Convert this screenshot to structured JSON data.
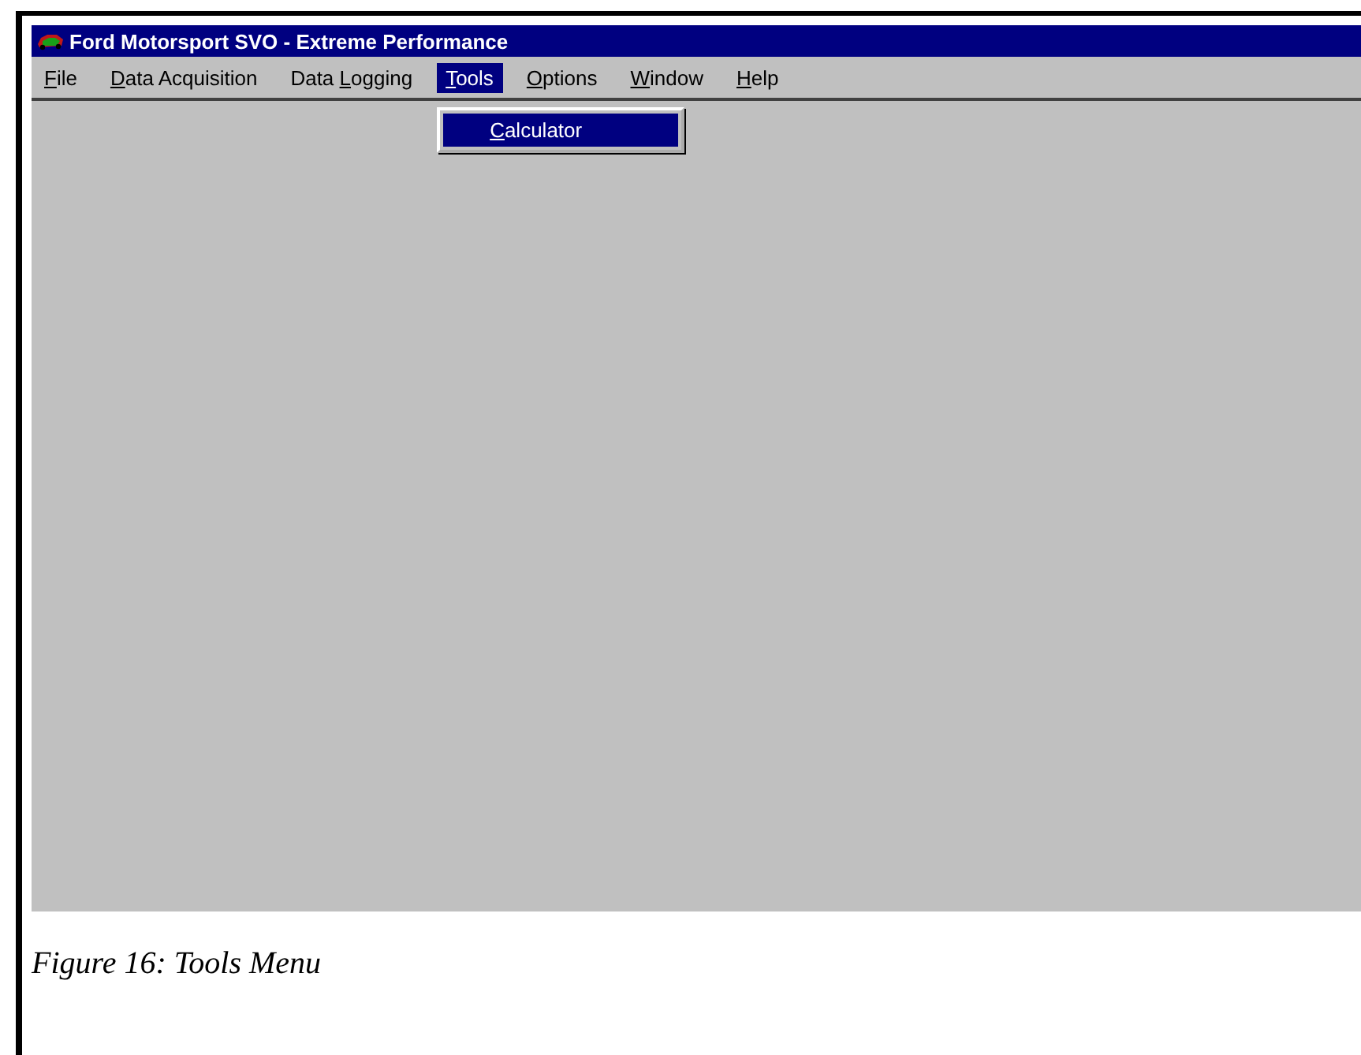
{
  "window": {
    "title": "Ford Motorsport SVO - Extreme Performance"
  },
  "menu_bar": [
    {
      "key": "F",
      "rest": "ile",
      "selected": false
    },
    {
      "key": "D",
      "rest": "ata Acquisition",
      "selected": false
    },
    {
      "before": "Data ",
      "key": "L",
      "rest": "ogging",
      "selected": false
    },
    {
      "key": "T",
      "rest": "ools",
      "selected": true
    },
    {
      "key": "O",
      "rest": "ptions",
      "selected": false
    },
    {
      "key": "W",
      "rest": "indow",
      "selected": false
    },
    {
      "key": "H",
      "rest": "elp",
      "selected": false
    }
  ],
  "open_menu": {
    "items": [
      {
        "key": "C",
        "rest": "alculator",
        "selected": true
      }
    ]
  },
  "caption": "Figure 16: Tools Menu"
}
